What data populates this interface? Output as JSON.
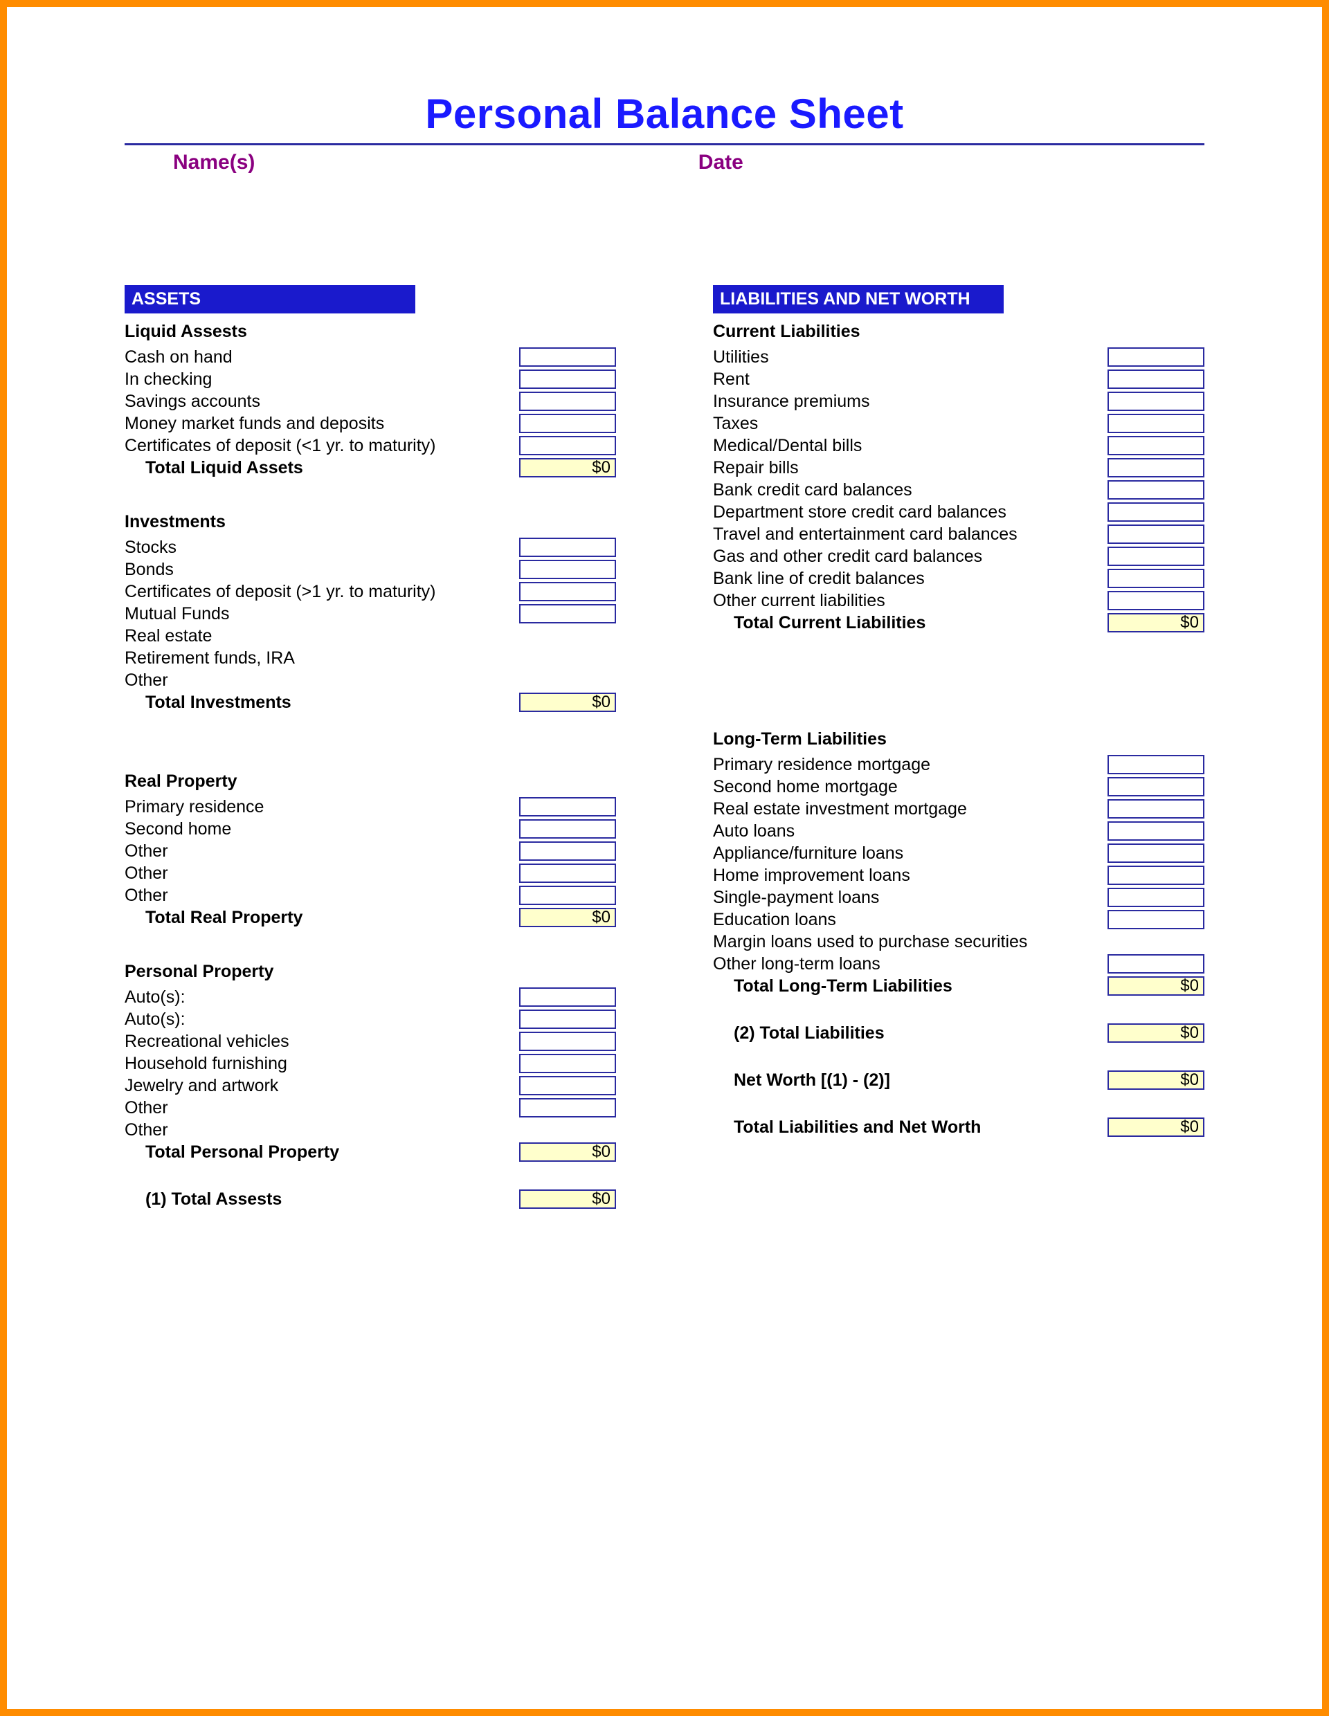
{
  "title": "Personal Balance Sheet",
  "header": {
    "names_label": "Name(s)",
    "date_label": "Date"
  },
  "left": {
    "banner": "ASSETS",
    "sec1": {
      "heading": "Liquid Assests",
      "i1": "Cash on hand",
      "i2": "In checking",
      "i3": "Savings accounts",
      "i4": "Money market funds and deposits",
      "i5": "Certificates of deposit (<1 yr. to maturity)",
      "total_label": "Total Liquid Assets",
      "total_value": "$0"
    },
    "sec2": {
      "heading": "Investments",
      "i1": "Stocks",
      "i2": "Bonds",
      "i3": "Certificates of deposit (>1 yr. to maturity)",
      "i4": "Mutual Funds",
      "i5": "Real estate",
      "i6": "Retirement funds, IRA",
      "i7": "Other",
      "total_label": "Total Investments",
      "total_value": "$0"
    },
    "sec3": {
      "heading": "Real Property",
      "i1": "Primary residence",
      "i2": "Second home",
      "i3": "Other",
      "i4": "Other",
      "i5": "Other",
      "total_label": "Total Real Property",
      "total_value": "$0"
    },
    "sec4": {
      "heading": "Personal Property",
      "i1": "Auto(s):",
      "i2": "Auto(s):",
      "i3": "Recreational vehicles",
      "i4": "Household furnishing",
      "i5": "Jewelry and artwork",
      "i6": "Other",
      "i7": "Other",
      "total_label": "Total Personal Property",
      "total_value": "$0"
    },
    "grand": {
      "label": "(1) Total Assests",
      "value": "$0"
    }
  },
  "right": {
    "banner": "LIABILITIES AND NET WORTH",
    "sec1": {
      "heading": "Current Liabilities",
      "i1": "Utilities",
      "i2": "Rent",
      "i3": "Insurance premiums",
      "i4": "Taxes",
      "i5": "Medical/Dental bills",
      "i6": "Repair bills",
      "i7": "Bank credit card balances",
      "i8": "Department store credit card balances",
      "i9": "Travel and entertainment card balances",
      "i10": "Gas and other credit card balances",
      "i11": "Bank line of credit balances",
      "i12": "Other current liabilities",
      "total_label": "Total Current Liabilities",
      "total_value": "$0"
    },
    "sec2": {
      "heading": "Long-Term Liabilities",
      "i1": "Primary residence mortgage",
      "i2": "Second home mortgage",
      "i3": "Real estate investment mortgage",
      "i4": "Auto loans",
      "i5": "Appliance/furniture loans",
      "i6": "Home improvement loans",
      "i7": "Single-payment loans",
      "i8": "Education loans",
      "i9": "Margin loans used to purchase securities",
      "i10": "Other long-term loans",
      "total_label": "Total Long-Term Liabilities",
      "total_value": "$0"
    },
    "total_liab": {
      "label": "(2) Total Liabilities",
      "value": "$0"
    },
    "net_worth": {
      "label": "Net Worth [(1) - (2)]",
      "value": "$0"
    },
    "total_lnw": {
      "label": "Total Liabilities and Net Worth",
      "value": "$0"
    }
  }
}
